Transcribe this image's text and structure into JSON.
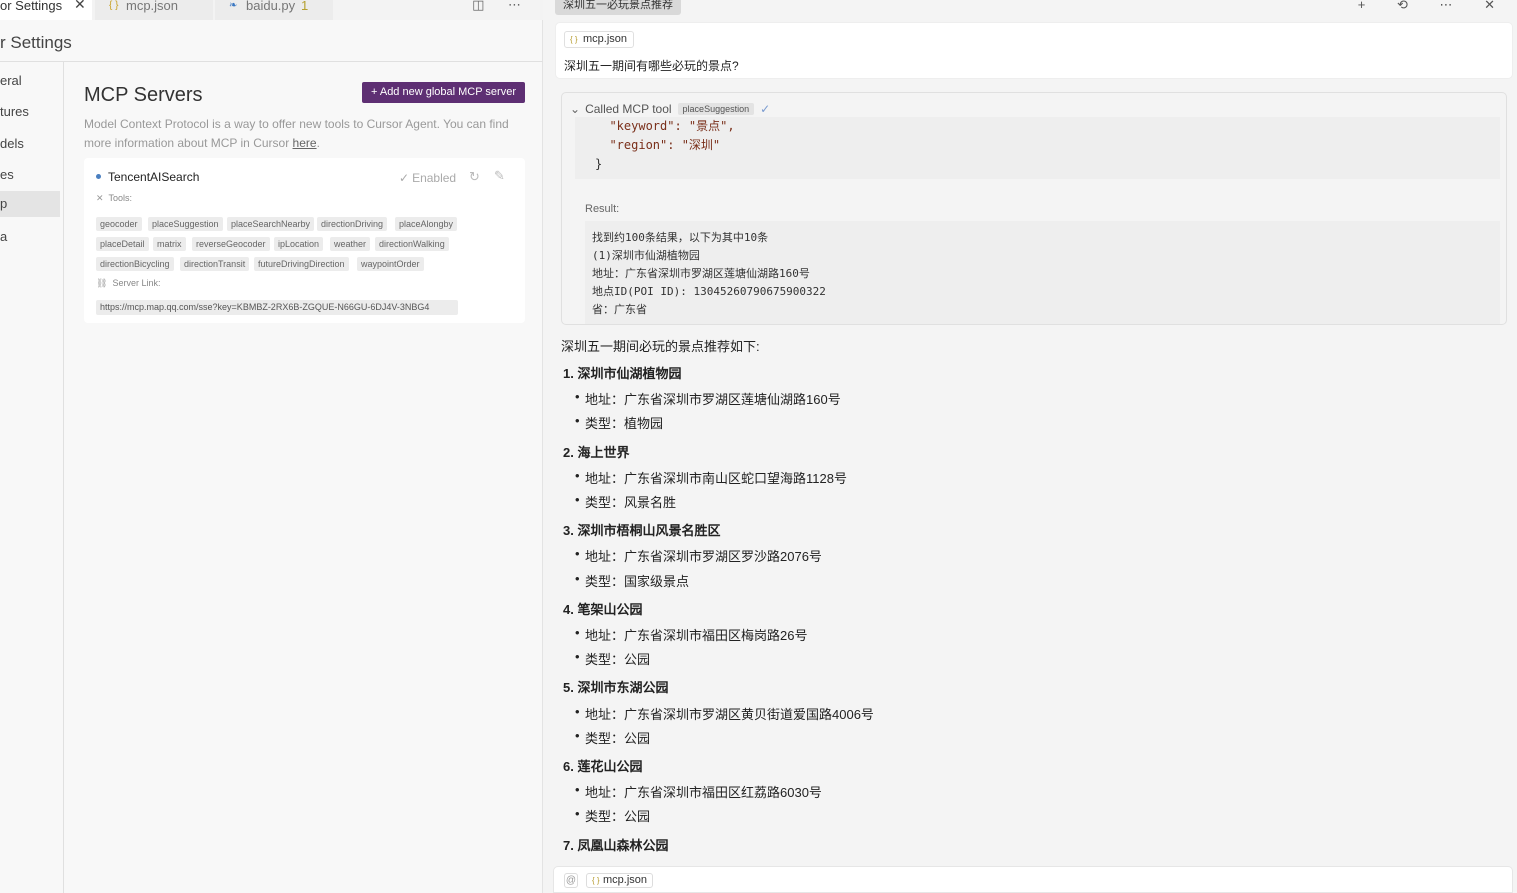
{
  "editor_tabs": {
    "active_label": "or Settings",
    "close_glyph": "✕",
    "tab2": {
      "icon": "{ }",
      "name": "mcp.json"
    },
    "tab3": {
      "icon": "❧",
      "name": "baidu.py",
      "badge": "1"
    },
    "actions": "◫ ⋯"
  },
  "settings": {
    "title": "r Settings",
    "nav": [
      "eral",
      "tures",
      "dels",
      "es",
      "p",
      "a"
    ],
    "selected_nav_index": 4
  },
  "mcp": {
    "title": "MCP Servers",
    "add_button": "+ Add new global MCP server",
    "description_pre": "Model Context Protocol is a way to offer new tools to Cursor Agent. You can find more information about MCP in Cursor ",
    "description_link": "here",
    "description_post": ".",
    "server": {
      "name": "TencentAISearch",
      "status": "Enabled",
      "tools_label": "Tools:",
      "tools": [
        "geocoder",
        "placeSuggestion",
        "placeSearchNearby",
        "directionDriving",
        "placeAlongby",
        "placeDetail",
        "matrix",
        "reverseGeocoder",
        "ipLocation",
        "weather",
        "directionWalking",
        "directionBicycling",
        "directionTransit",
        "futureDrivingDirection",
        "waypointOrder"
      ],
      "link_label": "Server Link:",
      "link": "https://mcp.map.qq.com/sse?key=KBMBZ-2RX6B-ZGQUE-N66GU-6DJ4V-3NBG4"
    }
  },
  "chat": {
    "title": "深圳五一必玩景点推荐",
    "actions": "+ ⟲ ⋯ ✕",
    "user_message": {
      "file": "mcp.json",
      "text": "深圳五一期间有哪些必玩的景点?"
    },
    "tool_call": {
      "label": "Called MCP tool",
      "tool": "placeSuggestion",
      "args_lines": [
        "  \"keyword\": \"景点\",",
        "  \"region\": \"深圳\"",
        "}"
      ],
      "result_label": "Result:",
      "result_lines": [
        "找到约100条结果，以下为其中10条",
        "(1)深圳市仙湖植物园",
        "地址：广东省深圳市罗湖区莲塘仙湖路160号",
        "地点ID(POI ID): 13045260790675900322",
        "省：广东省"
      ]
    },
    "answer": {
      "intro": "深圳五一期间必玩的景点推荐如下:",
      "places": [
        {
          "title": "1. 深圳市仙湖植物园",
          "address": "地址：广东省深圳市罗湖区莲塘仙湖路160号",
          "type": "类型：植物园"
        },
        {
          "title": "2. 海上世界",
          "address": "地址：广东省深圳市南山区蛇口望海路1128号",
          "type": "类型：风景名胜"
        },
        {
          "title": "3. 深圳市梧桐山风景名胜区",
          "address": "地址：广东省深圳市罗湖区罗沙路2076号",
          "type": "类型：国家级景点"
        },
        {
          "title": "4. 笔架山公园",
          "address": "地址：广东省深圳市福田区梅岗路26号",
          "type": "类型：公园"
        },
        {
          "title": "5. 深圳市东湖公园",
          "address": "地址：广东省深圳市罗湖区黄贝街道爱国路4006号",
          "type": "类型：公园"
        },
        {
          "title": "6. 莲花山公园",
          "address": "地址：广东省深圳市福田区红荔路6030号",
          "type": "类型：公园"
        },
        {
          "title": "7. 凤凰山森林公园"
        }
      ]
    },
    "input": {
      "at": "@",
      "file": "mcp.json"
    }
  }
}
